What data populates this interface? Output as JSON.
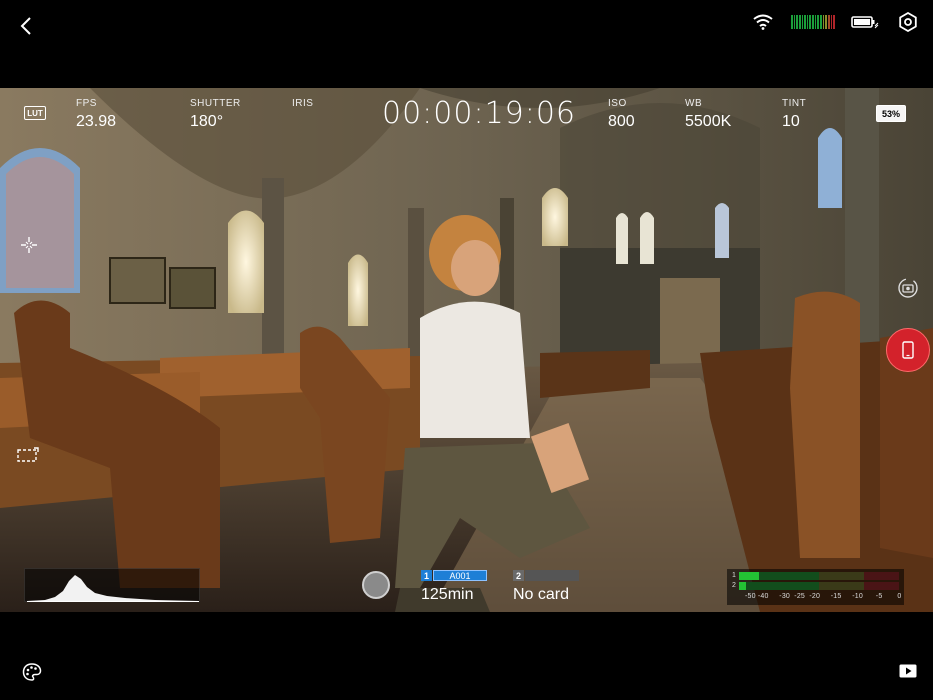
{
  "topbar": {
    "back_icon": "chevron-left-icon",
    "wifi_icon": "wifi-icon",
    "signal_icon": "signal-meter-icon",
    "power_icon": "battery-charging-icon",
    "settings_icon": "settings-gear-icon"
  },
  "hud": {
    "lut_label": "LUT",
    "fps_label": "FPS",
    "fps_value": "23.98",
    "shutter_label": "SHUTTER",
    "shutter_value": "180°",
    "iris_label": "IRIS",
    "timecode": "00:00:19:06",
    "iso_label": "ISO",
    "iso_value": "800",
    "wb_label": "WB",
    "wb_value": "5500K",
    "tint_label": "TINT",
    "tint_value": "10",
    "battery": "53%"
  },
  "media": {
    "slot1_number": "1",
    "slot1_clip": "A001",
    "slot1_remaining": "125min",
    "slot2_number": "2",
    "slot2_status": "No card"
  },
  "audio": {
    "ch1": "1",
    "ch2": "2",
    "scale": "-50 -40     -30  -25  -20     -15     -10      -5       0"
  },
  "bottombar": {
    "palette_icon": "palette-icon",
    "play_icon": "play-icon"
  },
  "colors": {
    "record": "#d3222b",
    "clip_blue": "#1e7fd6",
    "meter_green": "#23c234",
    "meter_red": "#b0252a"
  }
}
